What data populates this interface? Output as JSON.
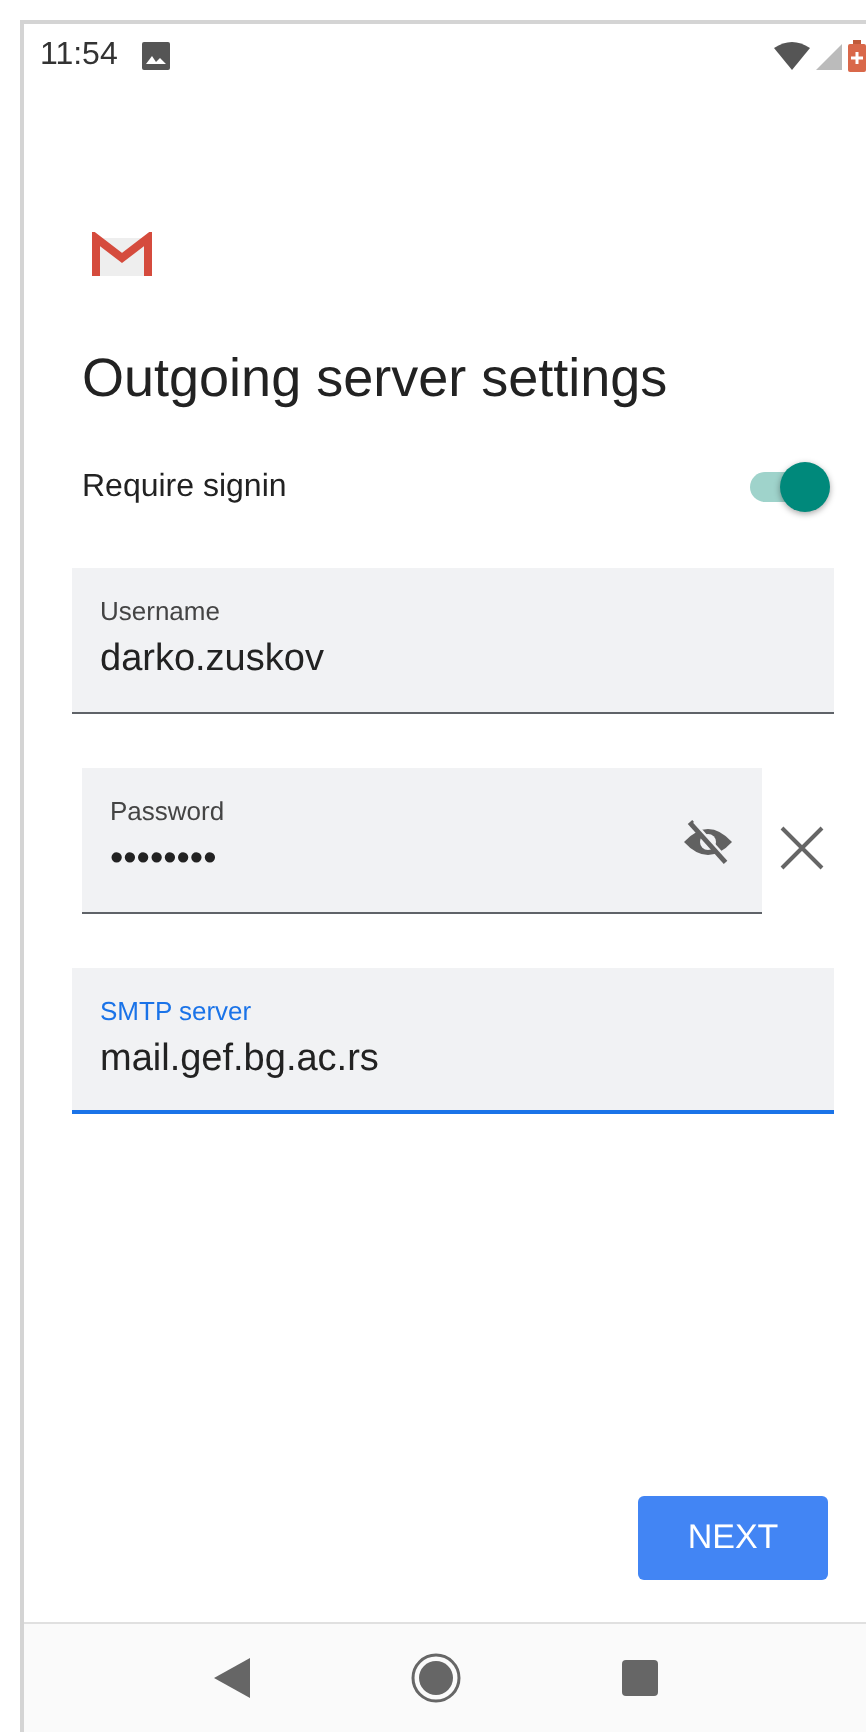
{
  "status_bar": {
    "time": "11:54"
  },
  "title": "Outgoing server settings",
  "require_signin": {
    "label": "Require signin",
    "on": true
  },
  "fields": [
    {
      "kind": "text",
      "label": "Username",
      "value": "darko.zuskov",
      "focused": false
    },
    {
      "kind": "password",
      "label": "Password",
      "value": "••••••••",
      "focused": false
    },
    {
      "kind": "text",
      "label": "SMTP server",
      "value": "mail.gef.bg.ac.rs",
      "focused": true
    }
  ],
  "next_button": "NEXT"
}
